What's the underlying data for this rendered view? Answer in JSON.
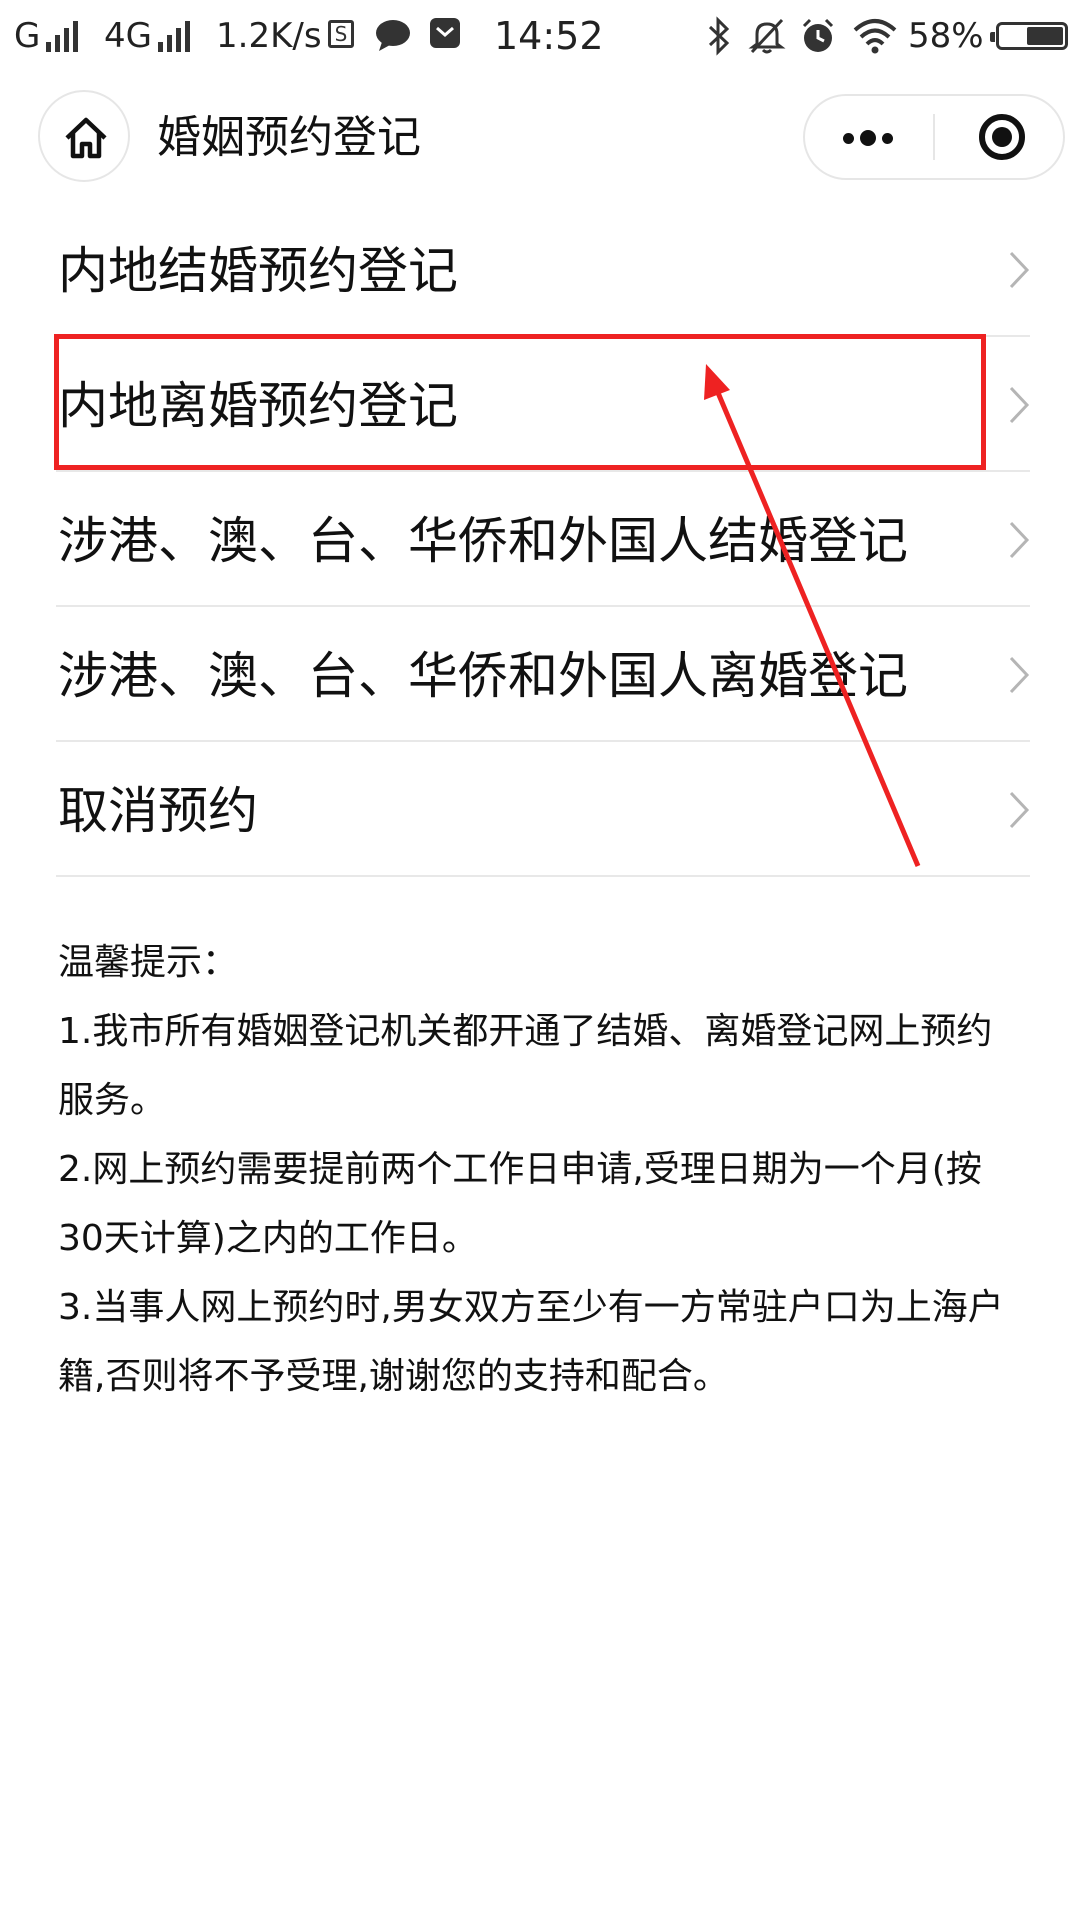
{
  "status_bar": {
    "network_1": "G",
    "network_2": "4G",
    "speed": "1.2K/s",
    "time": "14:52",
    "battery": "58%",
    "battery_level": 0.58,
    "icons": [
      "signal-icon",
      "data-saver-icon",
      "chat-icon",
      "mail-icon",
      "bluetooth-icon",
      "mute-icon",
      "alarm-icon",
      "wifi-icon",
      "battery-icon"
    ]
  },
  "nav": {
    "title": "婚姻预约登记",
    "home_icon": "home-icon",
    "more_icon": "more-icon",
    "close_icon": "close-target-icon"
  },
  "menu": {
    "items": [
      {
        "label": "内地结婚预约登记"
      },
      {
        "label": "内地离婚预约登记"
      },
      {
        "label": "涉港、澳、台、华侨和外国人结婚登记"
      },
      {
        "label": "涉港、澳、台、华侨和外国人离婚登记"
      },
      {
        "label": "取消预约"
      }
    ]
  },
  "notice": {
    "title": "温馨提示：",
    "lines": [
      "1.我市所有婚姻登记机关都开通了结婚、离婚登记网上预约服务。",
      "2.网上预约需要提前两个工作日申请,受理日期为一个月(按30天计算)之内的工作日。",
      "3.当事人网上预约时,男女双方至少有一方常驻户口为上海户籍,否则将不予受理,谢谢您的支持和配合。"
    ]
  },
  "annotation": {
    "color": "#ee2222"
  }
}
